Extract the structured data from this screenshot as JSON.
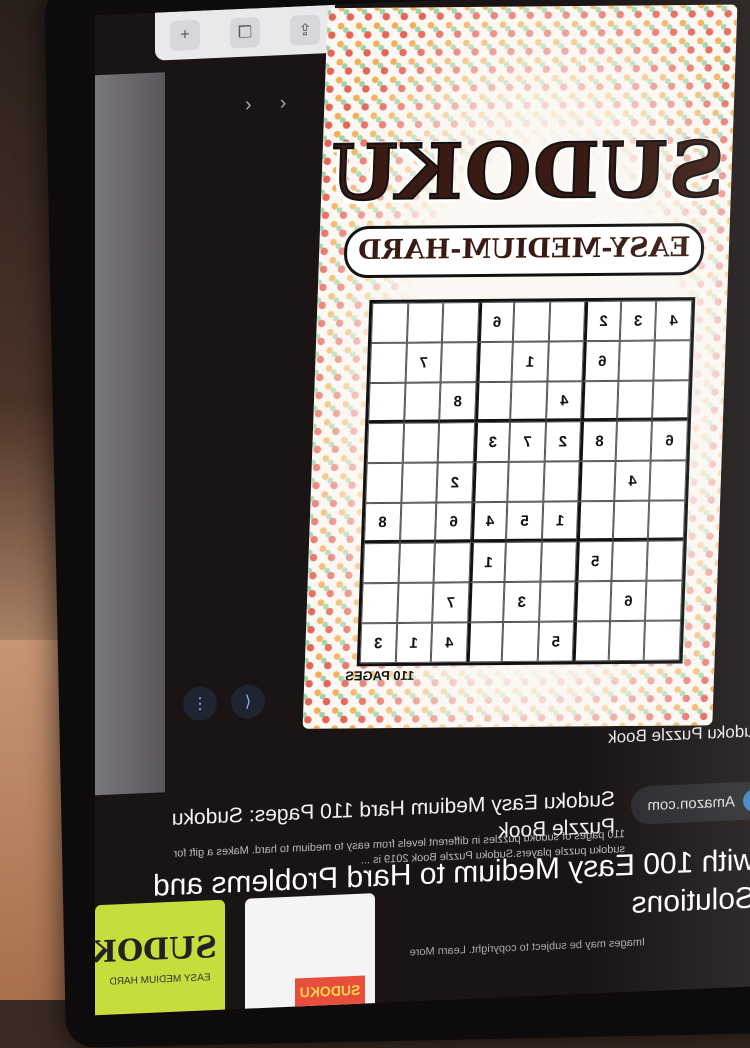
{
  "toolbar": {
    "add_icon": "plus-icon",
    "tabs_icon": "tabs-icon",
    "share_icon": "share-icon"
  },
  "nav": {
    "back_icon": "chevron-left-icon",
    "forward_icon": "chevron-right-icon"
  },
  "cover": {
    "title": "SUDOKU",
    "subtitle": "EASY-MEDIUM-HARD",
    "pages_label": "110 PAGES",
    "grid": [
      [
        "4",
        "3",
        "2",
        "",
        "",
        "6",
        "",
        "",
        ""
      ],
      [
        "",
        "",
        "6",
        "",
        "1",
        "",
        "",
        "7",
        ""
      ],
      [
        "",
        "",
        "",
        "4",
        "",
        "",
        "8",
        "",
        ""
      ],
      [
        "6",
        "",
        "8",
        "2",
        "7",
        "3",
        "",
        "",
        ""
      ],
      [
        "",
        "4",
        "",
        "",
        "",
        "",
        "2",
        "",
        ""
      ],
      [
        "",
        "",
        "",
        "1",
        "5",
        "4",
        "6",
        "",
        "8"
      ],
      [
        "",
        "",
        "5",
        "",
        "",
        "1",
        "",
        "",
        ""
      ],
      [
        "",
        "6",
        "",
        "",
        "3",
        "",
        "7",
        "",
        ""
      ],
      [
        "",
        "",
        "",
        "5",
        "",
        "",
        "4",
        "1",
        "3"
      ]
    ]
  },
  "actions": {
    "more_icon": "more-vertical-icon",
    "share_icon": "share-icon"
  },
  "result": {
    "category": "Sudoku Puzzle Book",
    "source": "Amazon.com",
    "title_line1": "Sudoku Easy Medium Hard 110 Pages: Sudoku Puzzle Book",
    "title_line2": "with 100 Easy Medium to Hard Problems and Solutions",
    "snippet": "110 pages of sudoku puzzles in different levels from easy to medium to hard. Makes a gift for sudoku puzzle players.Sudoku Puzzle Book 2019 is ...",
    "footer": "Images may be subject to copyright. Learn More"
  },
  "thumbs": [
    {
      "title": "SUDOKU",
      "subtitle": "EASY MEDIUM HARD"
    },
    {
      "badge": "SUDOKU"
    }
  ]
}
